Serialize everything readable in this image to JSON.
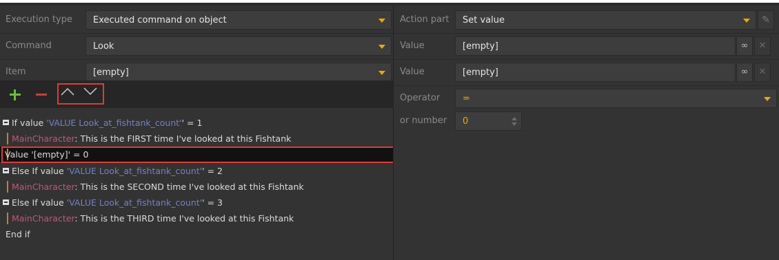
{
  "left": {
    "fields": [
      {
        "label": "Execution type",
        "value": "Executed command on object"
      },
      {
        "label": "Command",
        "value": "Look"
      },
      {
        "label": "Item",
        "value": "[empty]"
      }
    ],
    "toolbar": {
      "add": "add-icon",
      "remove": "remove-icon",
      "up": "chevron-up-icon",
      "down": "chevron-down-icon"
    },
    "lines": [
      {
        "kind": "if",
        "prefix": "If value ",
        "var": "'VALUE Look_at_fishtank_count'",
        "suffix": "' = 1"
      },
      {
        "kind": "say",
        "speaker": "MainCharacter",
        "text": ": This is the FIRST time I've looked at this Fishtank"
      },
      {
        "kind": "plain",
        "text": "Value '[empty]' = 0"
      },
      {
        "kind": "if",
        "prefix": "Else If value ",
        "var": "'VALUE Look_at_fishtank_count'",
        "suffix": "' = 2"
      },
      {
        "kind": "say",
        "speaker": "MainCharacter",
        "text": ": This is the SECOND time I've looked at this Fishtank"
      },
      {
        "kind": "if",
        "prefix": "Else If value ",
        "var": "'VALUE Look_at_fishtank_count'",
        "suffix": "' = 3"
      },
      {
        "kind": "say",
        "speaker": "MainCharacter",
        "text": ": This is the THIRD time I've looked at this Fishtank"
      },
      {
        "kind": "end",
        "text": "End if"
      }
    ]
  },
  "right": {
    "action_part": {
      "label": "Action part",
      "value": "Set value"
    },
    "value1": {
      "label": "Value",
      "value": "[empty]"
    },
    "value2": {
      "label": "Value",
      "value": "[empty]"
    },
    "operator": {
      "label": "Operator",
      "value": "="
    },
    "or_number": {
      "label": "or number",
      "value": "0"
    },
    "icons": {
      "link": "link-icon",
      "clear": "close-icon",
      "edit": "pencil-icon"
    }
  },
  "colors": {
    "accent": "#f0a800",
    "add": "#6abf3a",
    "remove": "#d23b3b",
    "variable": "#6f83c8",
    "speaker": "#c2557b",
    "highlight": "#e53935"
  }
}
